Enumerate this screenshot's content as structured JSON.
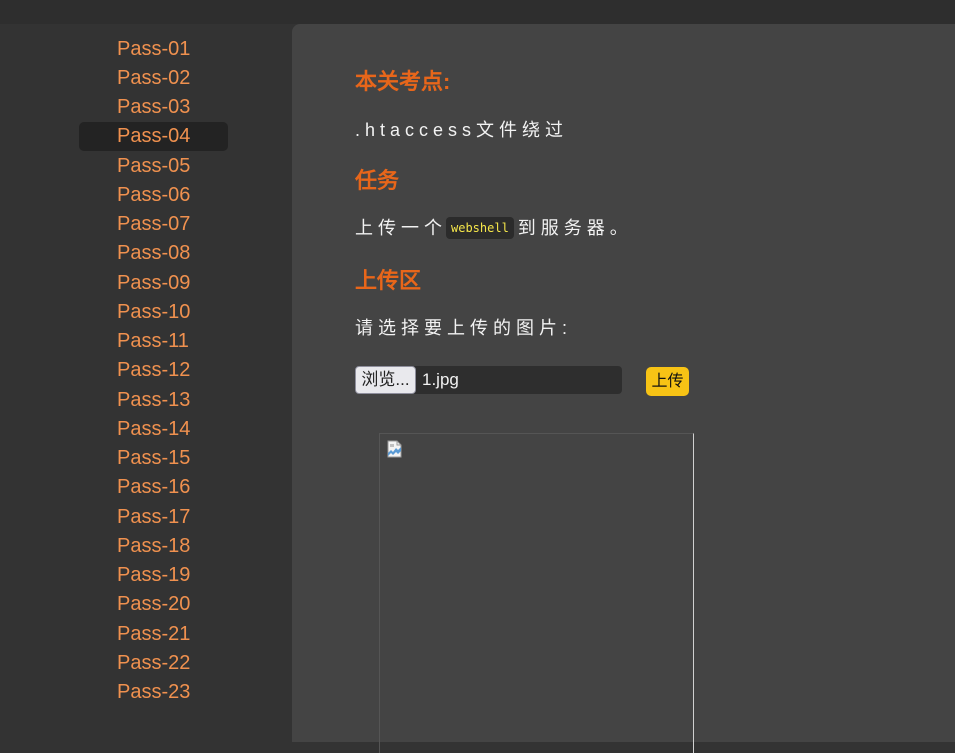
{
  "sidebar": {
    "items": [
      {
        "label": "Pass-01"
      },
      {
        "label": "Pass-02"
      },
      {
        "label": "Pass-03"
      },
      {
        "label": "Pass-04"
      },
      {
        "label": "Pass-05"
      },
      {
        "label": "Pass-06"
      },
      {
        "label": "Pass-07"
      },
      {
        "label": "Pass-08"
      },
      {
        "label": "Pass-09"
      },
      {
        "label": "Pass-10"
      },
      {
        "label": "Pass-11"
      },
      {
        "label": "Pass-12"
      },
      {
        "label": "Pass-13"
      },
      {
        "label": "Pass-14"
      },
      {
        "label": "Pass-15"
      },
      {
        "label": "Pass-16"
      },
      {
        "label": "Pass-17"
      },
      {
        "label": "Pass-18"
      },
      {
        "label": "Pass-19"
      },
      {
        "label": "Pass-20"
      },
      {
        "label": "Pass-21"
      },
      {
        "label": "Pass-22"
      },
      {
        "label": "Pass-23"
      }
    ],
    "active_label": "Pass-04"
  },
  "main": {
    "focus_heading": "本关考点:",
    "focus_text": ".htaccess文件绕过",
    "task_heading": "任务",
    "task_text_before": "上传一个",
    "task_code": "webshell",
    "task_text_after": "到服务器。",
    "upload_heading": "上传区",
    "upload_prompt": "请选择要上传的图片:",
    "browse_label": "浏览...",
    "file_name": "1.jpg",
    "upload_button": "上传",
    "preview_icon": "broken-image-icon"
  },
  "colors": {
    "accent_orange": "#e8661a",
    "link_orange": "#f0914f",
    "upload_yellow": "#f7c315",
    "code_yellow": "#f5e64a"
  }
}
